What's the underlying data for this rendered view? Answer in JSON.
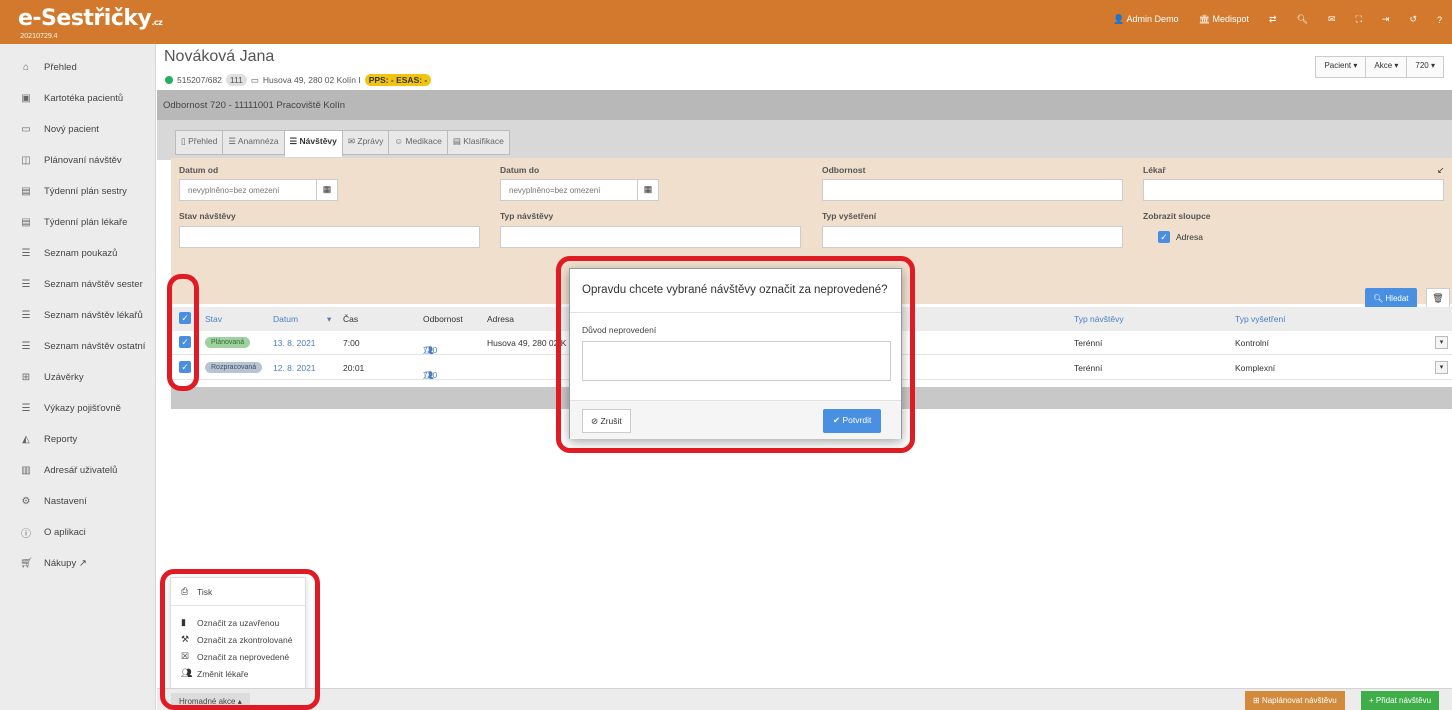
{
  "app": {
    "logo": "e-Sestřičky",
    "logo_tld": ".cz",
    "version": "20210729.4"
  },
  "topnav": {
    "user": "Admin Demo",
    "org": "Medispot",
    "icons": [
      "exchange-icon",
      "search-icon",
      "mail-icon",
      "fullscreen-icon",
      "logout-icon",
      "history-icon",
      "help-icon"
    ]
  },
  "sidebar": {
    "items": [
      {
        "label": "Přehled",
        "icon": "home-icon"
      },
      {
        "label": "Kartotéka pacientů",
        "icon": "card-icon"
      },
      {
        "label": "Nový pacient",
        "icon": "id-card-icon"
      },
      {
        "label": "Plánovaní návštěv",
        "icon": "map-icon"
      },
      {
        "label": "Týdenní plán sestry",
        "icon": "calendar-icon"
      },
      {
        "label": "Týdenní plán lékaře",
        "icon": "calendar-icon"
      },
      {
        "label": "Seznam poukazů",
        "icon": "list-icon"
      },
      {
        "label": "Seznam návštěv sester",
        "icon": "list-icon"
      },
      {
        "label": "Seznam návštěv lékařů",
        "icon": "list-icon"
      },
      {
        "label": "Seznam návštěv ostatní",
        "icon": "list-icon"
      },
      {
        "label": "Uzávěrky",
        "icon": "grid-icon"
      },
      {
        "label": "Výkazy pojišťovně",
        "icon": "list-icon"
      },
      {
        "label": "Reporty",
        "icon": "chart-icon"
      },
      {
        "label": "Adresář uživatelů",
        "icon": "book-icon"
      },
      {
        "label": "Nastavení",
        "icon": "gears-icon"
      },
      {
        "label": "O aplikaci",
        "icon": "info-icon"
      },
      {
        "label": "Nákupy",
        "icon": "cart-icon"
      }
    ]
  },
  "patient": {
    "name": "Nováková Jana",
    "id": "515207/682",
    "insurance": "111",
    "address": "Husova 49, 280 02 Kolín I",
    "pps": "PPS: - ESAS: -"
  },
  "header_buttons": {
    "patient": "Pacient ▾",
    "actions": "Akce ▾",
    "code": "720 ▾"
  },
  "department": "Odbornost 720 - 11111001 Pracoviště Kolín",
  "tabs": [
    {
      "label": "Přehled",
      "icon": "▯"
    },
    {
      "label": "Anamnéza",
      "icon": "☰"
    },
    {
      "label": "Návštěvy",
      "icon": "☰"
    },
    {
      "label": "Zprávy",
      "icon": "✉"
    },
    {
      "label": "Medikace",
      "icon": "☺"
    },
    {
      "label": "Klasifikace",
      "icon": "▤"
    }
  ],
  "filters": {
    "date_from_label": "Datum od",
    "date_from_placeholder": "nevyplněno=bez omezení",
    "date_to_label": "Datum do",
    "date_to_placeholder": "nevyplněno=bez omezení",
    "specialty_label": "Odbornost",
    "doctor_label": "Lékař",
    "visit_state_label": "Stav návštěvy",
    "visit_type_label": "Typ návštěvy",
    "exam_type_label": "Typ vyšetření",
    "show_columns_label": "Zobrazit sloupce",
    "address_checkbox_label": "Adresa",
    "search_button": "Hledat"
  },
  "table": {
    "headers": {
      "state": "Stav",
      "date": "Datum",
      "time": "Čas",
      "specialty": "Odbornost",
      "address": "Adresa",
      "visit_type": "Typ návštěvy",
      "exam_type": "Typ vyšetření"
    },
    "rows": [
      {
        "state": "Plánovaná",
        "date": "13. 8. 2021",
        "time": "7:00",
        "specialty": "720",
        "address": "Husova 49, 280 02 K",
        "visit_type": "Terénní",
        "exam_type": "Kontrolní"
      },
      {
        "state": "Rozpracovaná",
        "date": "12. 8. 2021",
        "time": "20:01",
        "specialty": "720",
        "address": "",
        "visit_type": "Terénní",
        "exam_type": "Komplexní"
      }
    ]
  },
  "modal": {
    "title": "Opravdu chcete vybrané návštěvy označit za neprovedené?",
    "reason_label": "Důvod neprovedení",
    "reason_value": "",
    "cancel": "Zrušit",
    "confirm": "Potvrdit"
  },
  "bulk_menu": {
    "print": "Tisk",
    "items": [
      {
        "label": "Označit za uzavřenou",
        "icon": "clipboard-icon"
      },
      {
        "label": "Označit za zkontrolované",
        "icon": "gavel-icon"
      },
      {
        "label": "Označit za neprovedené",
        "icon": "x-square-icon"
      },
      {
        "label": "Změnit lékaře",
        "icon": "users-icon"
      }
    ]
  },
  "bottombar": {
    "bulk_actions": "Hromadné akce ▴",
    "plan_visit": "Naplánovat návštěvu",
    "add_visit": "+ Přidat návštěvu"
  },
  "colors": {
    "topbar": "#d2792d",
    "accent_blue": "#4a90e2",
    "highlight_red": "#e01b24",
    "filter_bg": "#f0dfcd"
  }
}
